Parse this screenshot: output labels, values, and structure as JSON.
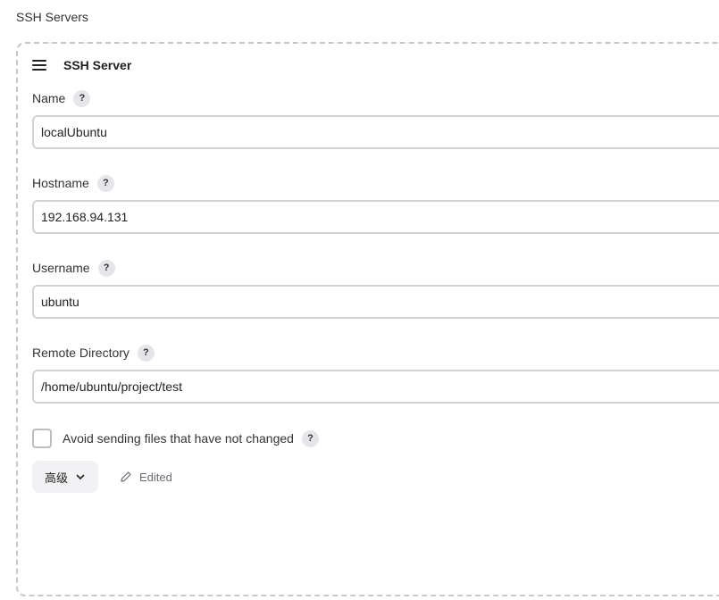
{
  "section": {
    "title": "SSH Servers"
  },
  "server": {
    "header_title": "SSH Server",
    "fields": {
      "name": {
        "label": "Name",
        "value": "localUbuntu"
      },
      "hostname": {
        "label": "Hostname",
        "value": "192.168.94.131"
      },
      "username": {
        "label": "Username",
        "value": "ubuntu"
      },
      "remote_directory": {
        "label": "Remote Directory",
        "value": "/home/ubuntu/project/test"
      }
    },
    "help_glyph": "?",
    "avoid_sending": {
      "label": "Avoid sending files that have not changed",
      "checked": false
    },
    "advanced_label": "高级",
    "edited_label": "Edited"
  },
  "icons": {
    "drag_handle": "drag-handle-icon",
    "help": "help-icon",
    "chevron": "chevron-down-icon",
    "pencil": "pencil-icon"
  },
  "colors": {
    "border_dashed": "#c8c8cc",
    "input_border": "#d3d3d6",
    "help_bg": "#e6e6ea",
    "button_bg": "#f2f2f4",
    "muted_text": "#6b6b75"
  }
}
